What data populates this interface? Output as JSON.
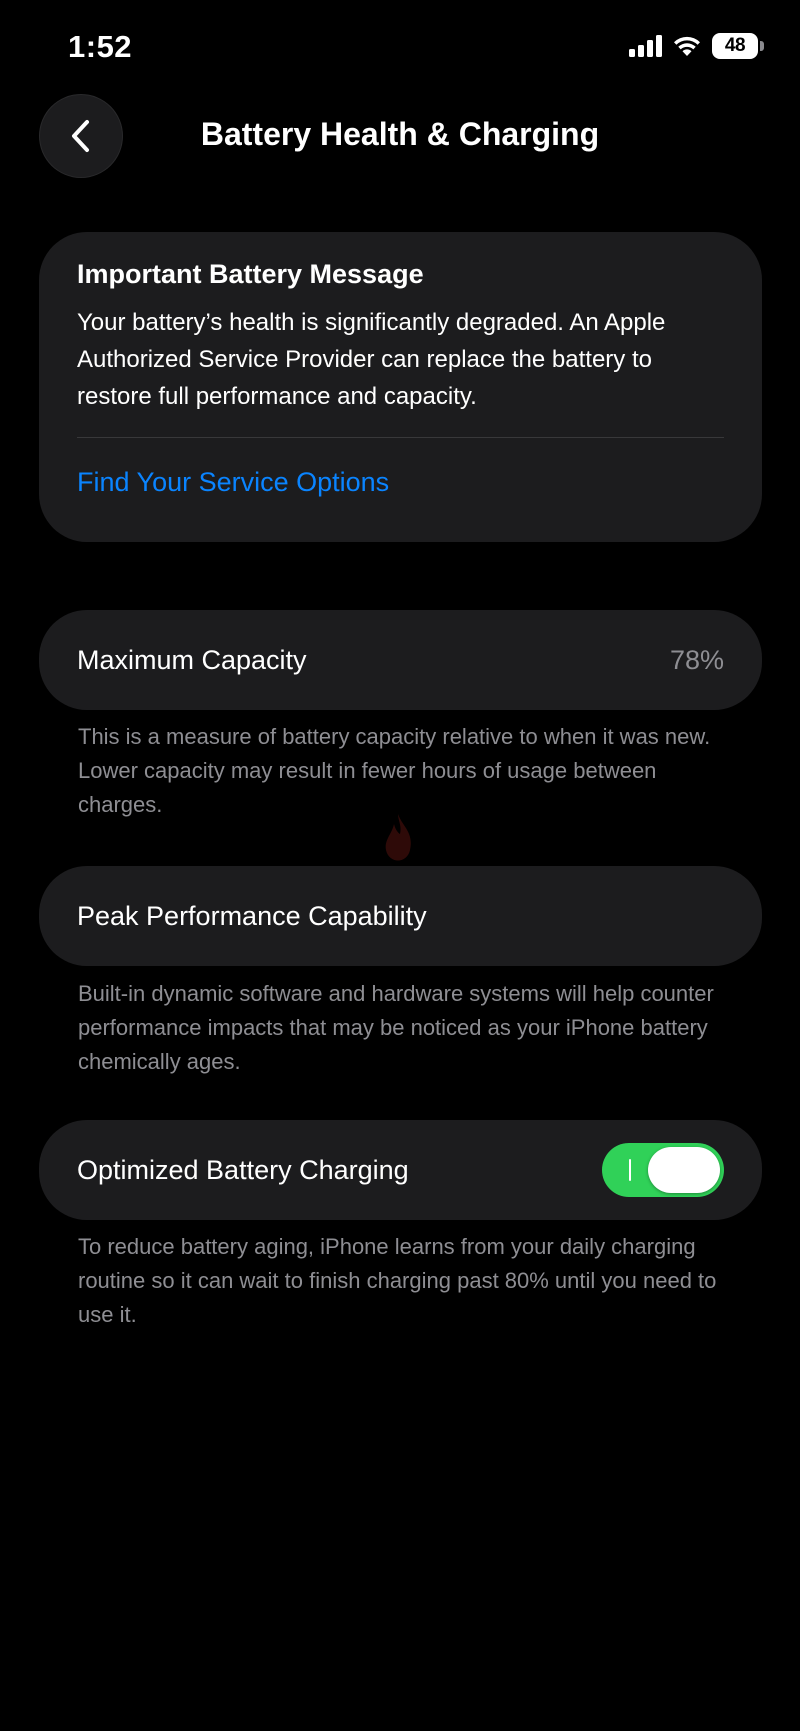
{
  "status_bar": {
    "time": "1:52",
    "battery_level": "48",
    "battery_level_fraction": 0.48,
    "icons": [
      "cellular-signal-icon",
      "wifi-icon",
      "battery-icon"
    ]
  },
  "nav": {
    "back_icon": "chevron-left-icon",
    "title": "Battery Health & Charging"
  },
  "battery_message": {
    "title": "Important Battery Message",
    "body": "Your battery’s health is significantly degraded. An Apple Authorized Service Provider can replace the battery to restore full performance and capacity.",
    "link": "Find Your Service Options"
  },
  "maximum_capacity": {
    "label": "Maximum Capacity",
    "value": "78%",
    "note": "This is a measure of battery capacity relative to when it was new. Lower capacity may result in fewer hours of usage between charges."
  },
  "peak_performance": {
    "label": "Peak Performance Capability",
    "note": "Built-in dynamic software and hardware systems will help counter performance impacts that may be noticed as your iPhone battery chemically ages."
  },
  "optimized_charging": {
    "label": "Optimized Battery Charging",
    "enabled": true,
    "note": "To reduce battery aging, iPhone learns from your daily charging routine so it can wait to finish charging past 80% until you need to use it."
  },
  "colors": {
    "background": "#000000",
    "card": "#1c1c1e",
    "link": "#0a84ff",
    "toggle_on": "#30d158",
    "secondary_text": "#8e8e93"
  }
}
